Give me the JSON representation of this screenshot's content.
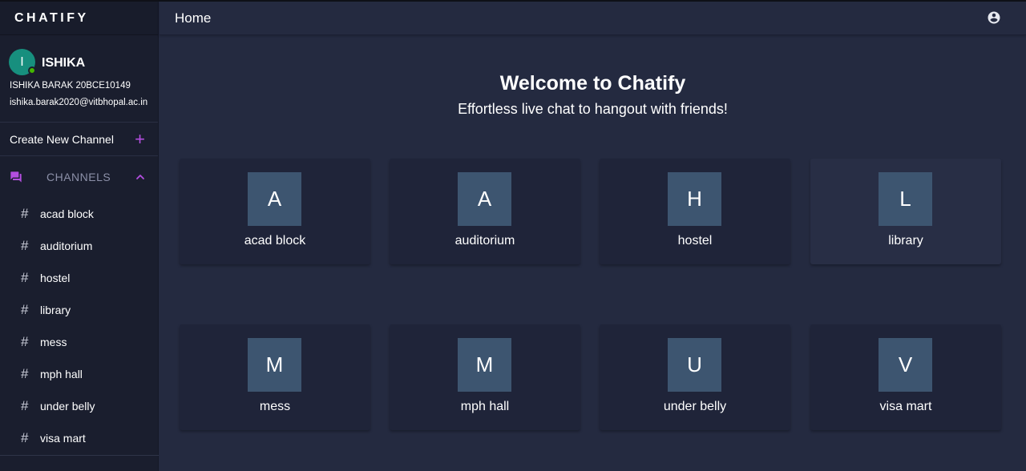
{
  "sidebar": {
    "brand": "CHATIFY",
    "profile": {
      "initial": "I",
      "name": "ISHIKA",
      "id_line": "ISHIKA BARAK 20BCE10149",
      "email": "ishika.barak2020@vitbhopal.ac.in",
      "status": "online"
    },
    "create_channel_label": "Create New Channel",
    "create_channel_icon": "plus-icon",
    "channels_header": "CHANNELS",
    "channels_icon": "chat-bubbles-icon",
    "channels_collapse_icon": "chevron-up-icon",
    "channels": [
      {
        "label": "acad block"
      },
      {
        "label": "auditorium"
      },
      {
        "label": "hostel"
      },
      {
        "label": "library"
      },
      {
        "label": "mess"
      },
      {
        "label": "mph hall"
      },
      {
        "label": "under belly"
      },
      {
        "label": "visa mart"
      }
    ]
  },
  "header": {
    "title": "Home",
    "account_icon": "account-circle-icon"
  },
  "main": {
    "welcome_title": "Welcome to Chatify",
    "welcome_subtitle": "Effortless live chat to hangout with friends!",
    "cards": [
      {
        "letter": "A",
        "name": "acad block"
      },
      {
        "letter": "A",
        "name": "auditorium"
      },
      {
        "letter": "H",
        "name": "hostel"
      },
      {
        "letter": "L",
        "name": "library"
      },
      {
        "letter": "M",
        "name": "mess"
      },
      {
        "letter": "M",
        "name": "mph hall"
      },
      {
        "letter": "U",
        "name": "under belly"
      },
      {
        "letter": "V",
        "name": "visa mart"
      }
    ]
  },
  "colors": {
    "accent": "#b44ee0",
    "tile": "#3d5570",
    "avatar": "#178f7e",
    "online": "#44b700"
  }
}
